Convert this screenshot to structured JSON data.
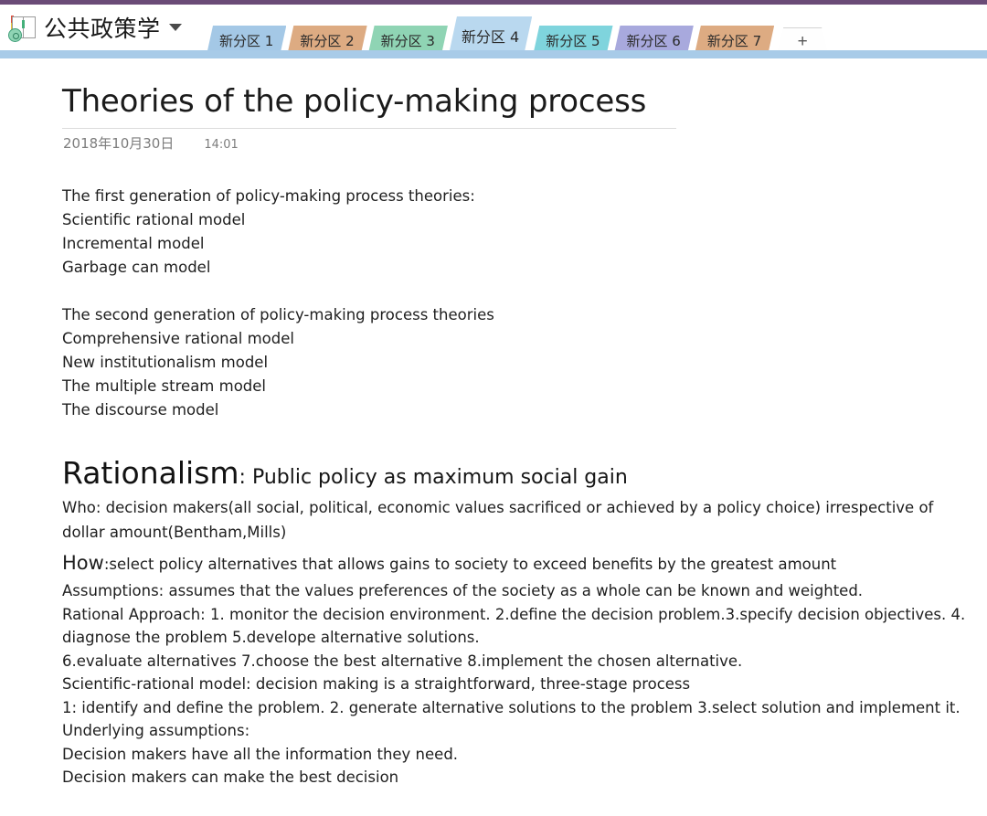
{
  "window": {
    "accent_strip_color": "#6b4b77",
    "tab_underline_color": "#a8cbe8"
  },
  "notebook": {
    "name": "公共政策学",
    "icon": "notebook-icon",
    "dropdown_icon": "chevron-down-icon"
  },
  "tabs": {
    "items": [
      {
        "label": "新分区 1",
        "color": "#a4c8e6",
        "active": false
      },
      {
        "label": "新分区 2",
        "color": "#ddab82",
        "active": false
      },
      {
        "label": "新分区 3",
        "color": "#8fd4b4",
        "active": false
      },
      {
        "label": "新分区 4",
        "color": "#b9d8ef",
        "active": true
      },
      {
        "label": "新分区 5",
        "color": "#7fd4dd",
        "active": false
      },
      {
        "label": "新分区 6",
        "color": "#a8a9dd",
        "active": false
      },
      {
        "label": "新分区 7",
        "color": "#ddab82",
        "active": false
      }
    ],
    "add_label": "+"
  },
  "page": {
    "title": "Theories of the policy-making process",
    "date": "2018年10月30日",
    "time": "14:01",
    "gen1": [
      "The first generation of policy-making process theories:",
      "Scientific rational model",
      "Incremental model",
      "Garbage can model"
    ],
    "gen2": [
      "The second generation of policy-making process theories",
      "Comprehensive rational model",
      "New institutionalism model",
      "The multiple stream model",
      "The discourse model"
    ],
    "heading": {
      "main": "Rationalism",
      "sub": ": Public policy as maximum social gain"
    },
    "who": "Who: decision makers(all social, political, economic values sacrificed or achieved by a policy choice) irrespective of dollar amount(Bentham,Mills)",
    "how_lead": "How",
    "how_rest": ":select policy alternatives that allows gains to society to exceed benefits by the greatest amount",
    "body_lines": [
      "Assumptions: assumes that the values preferences of the society as a whole can be known and weighted.",
      "Rational Approach: 1. monitor the decision environment. 2.define the decision problem.3.specify decision objectives. 4. diagnose the problem 5.develope alternative solutions.",
      "6.evaluate alternatives 7.choose the best alternative 8.implement the chosen alternative.",
      "Scientific-rational model: decision making is a straightforward, three-stage process",
      "1: identify and define the problem. 2. generate alternative solutions to the problem 3.select solution and implement it.",
      "Underlying assumptions:",
      "Decision makers have all the information they need.",
      "Decision makers can make the best decision"
    ]
  }
}
